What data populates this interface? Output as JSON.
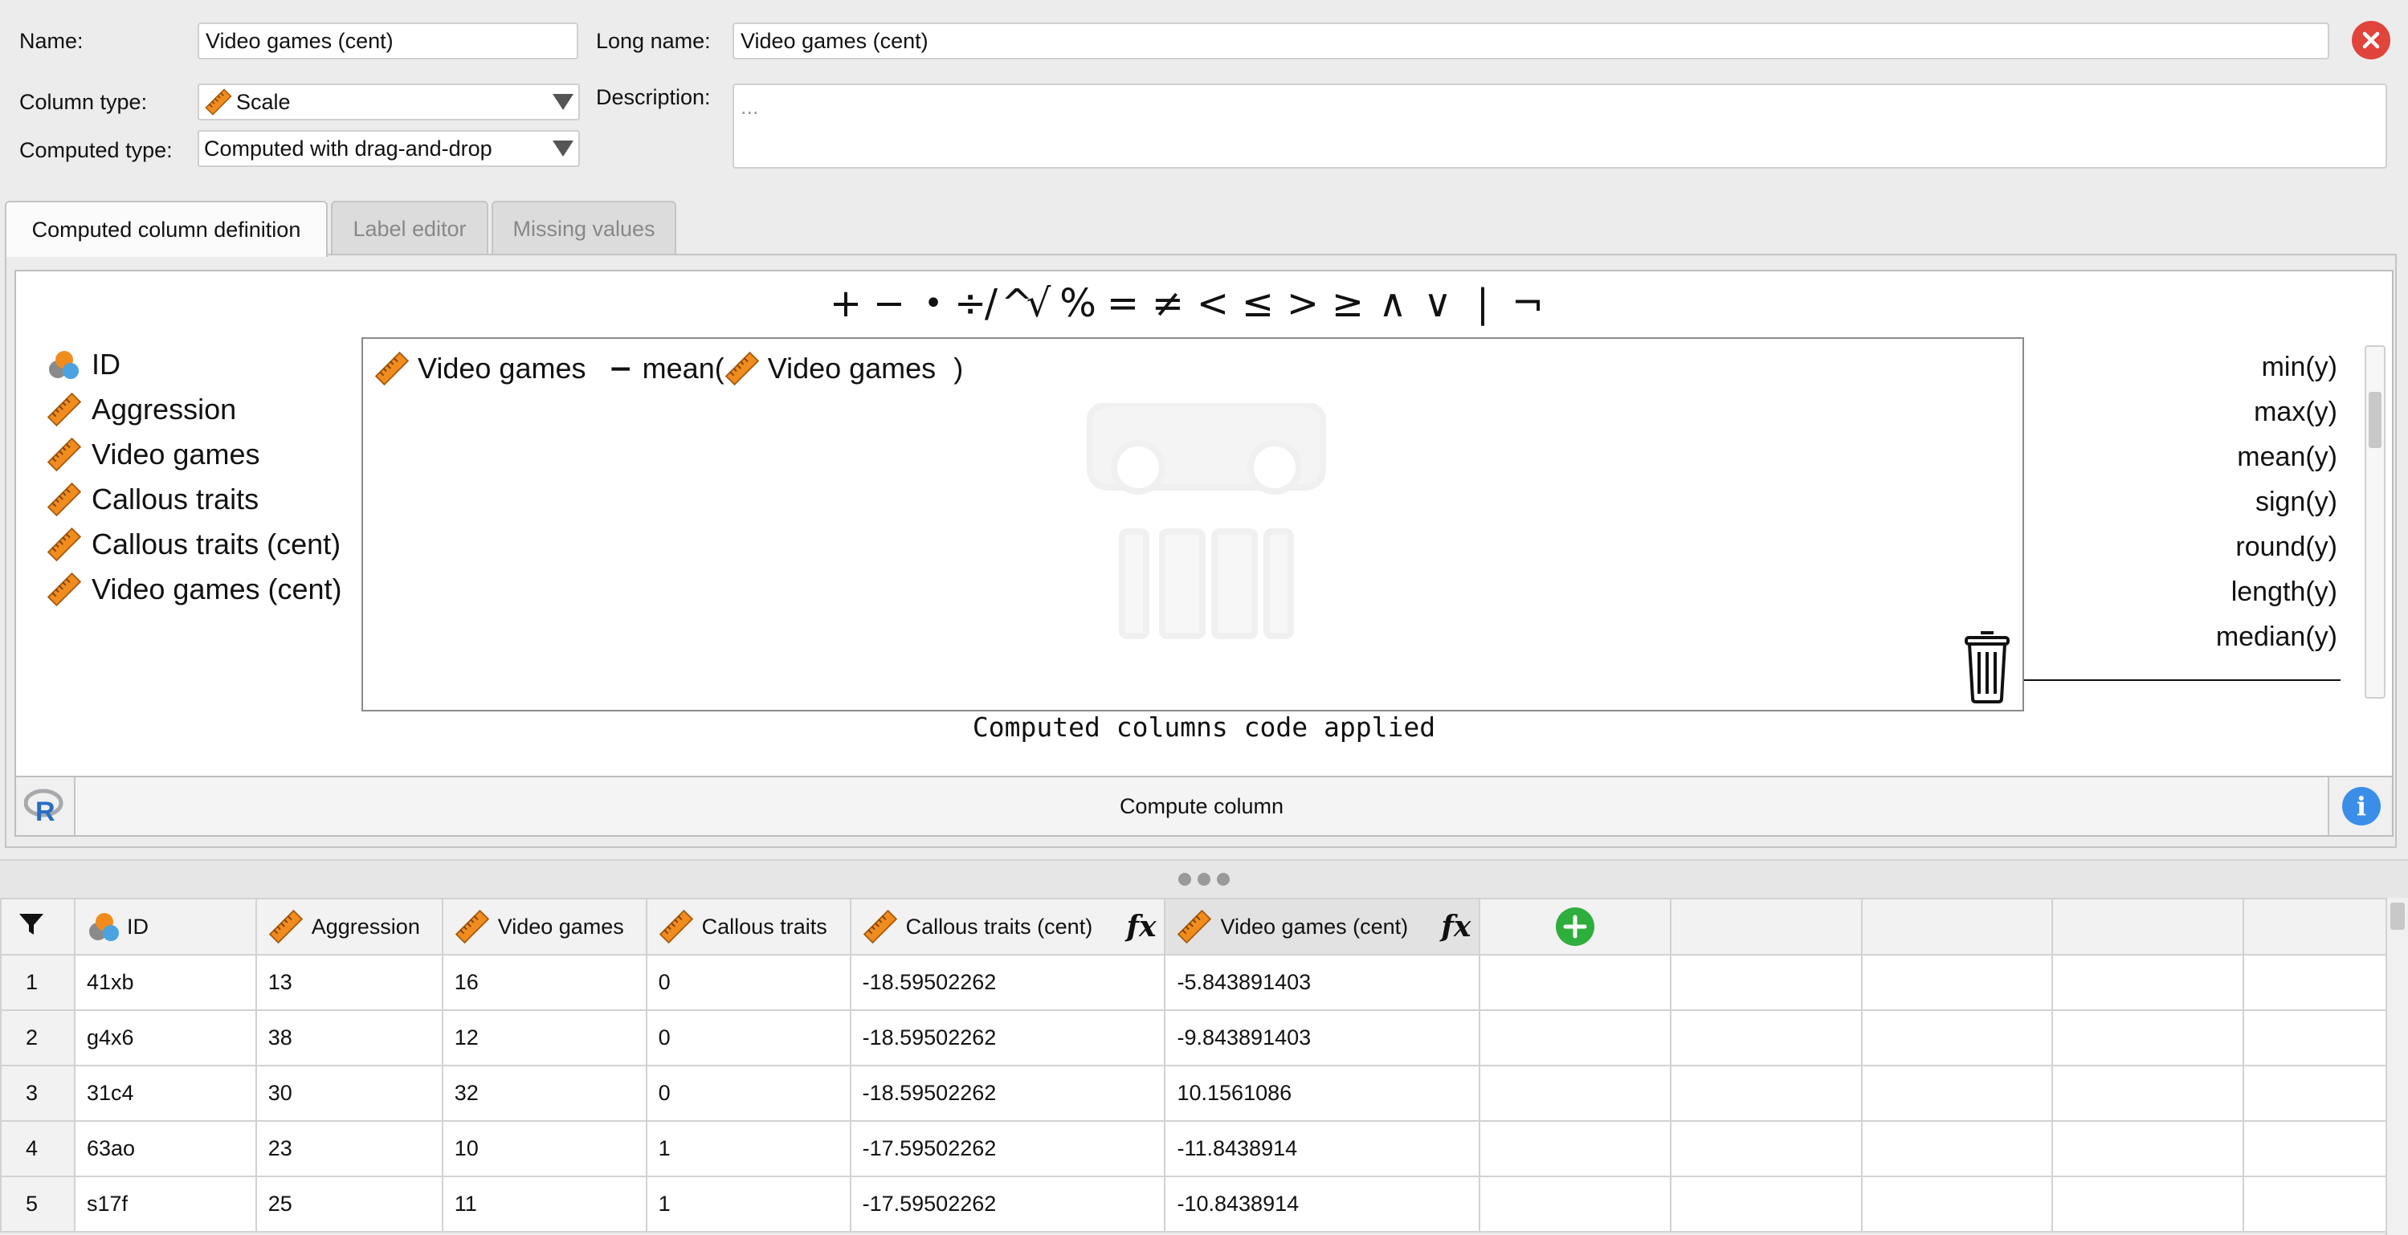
{
  "properties": {
    "name_label": "Name:",
    "name_value": "Video games (cent)",
    "long_name_label": "Long name:",
    "long_name_value": "Video games (cent)",
    "column_type_label": "Column type:",
    "column_type_value": "Scale",
    "description_label": "Description:",
    "description_placeholder": "...",
    "computed_type_label": "Computed type:",
    "computed_type_value": "Computed with drag-and-drop",
    "close_icon": "close-icon",
    "close_color": "#e0443a"
  },
  "tabs": [
    {
      "label": "Computed column definition",
      "active": true
    },
    {
      "label": "Label editor",
      "active": false
    },
    {
      "label": "Missing values",
      "active": false
    }
  ],
  "operators": [
    "+",
    "−",
    "•",
    "÷",
    "/",
    "^",
    "√",
    "%",
    "=",
    "≠",
    "<",
    "≤",
    ">",
    "≥",
    "∧",
    "∨",
    "|",
    "¬"
  ],
  "variables": [
    {
      "label": "ID",
      "icon": "nominal-icon"
    },
    {
      "label": "Aggression",
      "icon": "scale-icon"
    },
    {
      "label": "Video games",
      "icon": "scale-icon"
    },
    {
      "label": "Callous traits",
      "icon": "scale-icon"
    },
    {
      "label": "Callous traits (cent)",
      "icon": "scale-icon"
    },
    {
      "label": "Video games (cent)",
      "icon": "scale-icon"
    }
  ],
  "formula": {
    "operand1": "Video games",
    "operator": "−",
    "function": "mean(",
    "operand2": "Video games",
    "close": ")"
  },
  "functions": [
    "min(y)",
    "max(y)",
    "mean(y)",
    "sign(y)",
    "round(y)",
    "length(y)",
    "median(y)"
  ],
  "status": "Computed columns code applied",
  "compute_button": "Compute column",
  "info_icon": "i",
  "accent_colors": {
    "scale": "#f08c1e",
    "add": "#2eae3c",
    "info": "#3b8ee8"
  },
  "grid": {
    "columns": [
      {
        "label": "ID",
        "icon": "nominal-icon",
        "computed": false
      },
      {
        "label": "Aggression",
        "icon": "scale-icon",
        "computed": false
      },
      {
        "label": "Video games",
        "icon": "scale-icon",
        "computed": false
      },
      {
        "label": "Callous traits",
        "icon": "scale-icon",
        "computed": false
      },
      {
        "label": "Callous traits (cent)",
        "icon": "scale-icon",
        "computed": true
      },
      {
        "label": "Video games (cent)",
        "icon": "scale-icon",
        "computed": true
      }
    ],
    "rows": [
      {
        "n": "1",
        "cells": [
          "41xb",
          "13",
          "16",
          "0",
          "-18.59502262",
          "-5.843891403"
        ]
      },
      {
        "n": "2",
        "cells": [
          "g4x6",
          "38",
          "12",
          "0",
          "-18.59502262",
          "-9.843891403"
        ]
      },
      {
        "n": "3",
        "cells": [
          "31c4",
          "30",
          "32",
          "0",
          "-18.59502262",
          "10.1561086"
        ]
      },
      {
        "n": "4",
        "cells": [
          "63ao",
          "23",
          "10",
          "1",
          "-17.59502262",
          "-11.8438914"
        ]
      },
      {
        "n": "5",
        "cells": [
          "s17f",
          "25",
          "11",
          "1",
          "-17.59502262",
          "-10.8438914"
        ]
      }
    ]
  }
}
